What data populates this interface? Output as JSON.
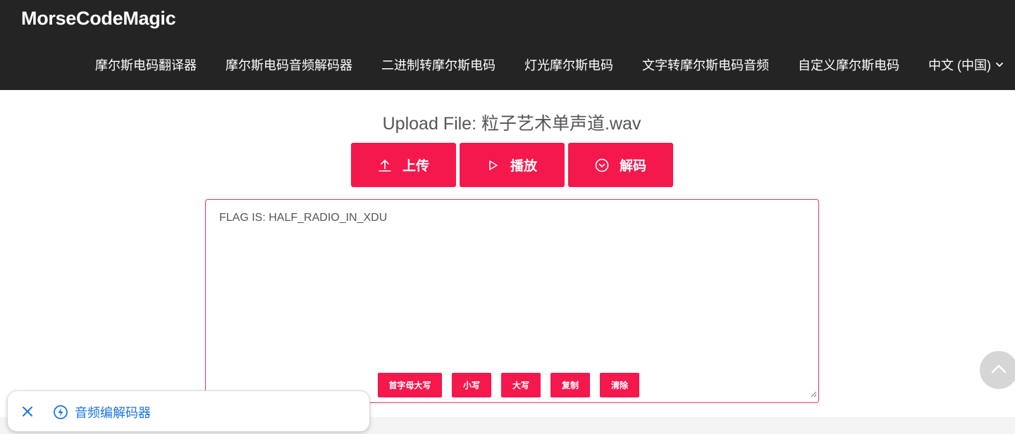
{
  "brand": "MorseCodeMagic",
  "nav": {
    "items": [
      "摩尔斯电码翻译器",
      "摩尔斯电码音频解码器",
      "二进制转摩尔斯电码",
      "灯光摩尔斯电码",
      "文字转摩尔斯电码音频",
      "自定义摩尔斯电码"
    ],
    "language": "中文 (中国)"
  },
  "upload": {
    "title": "Upload File: 粒子艺术单声道.wav"
  },
  "actions": {
    "upload_label": "上传",
    "play_label": "播放",
    "decode_label": "解码"
  },
  "output": {
    "text": "FLAG IS: HALF_RADIO_IN_XDU"
  },
  "text_tools": {
    "capitalize": "首字母大写",
    "lowercase": "小写",
    "uppercase": "大写",
    "copy": "复制",
    "clear": "清除"
  },
  "toast": {
    "label": "音频编解码器"
  },
  "colors": {
    "accent": "#f5184d",
    "navbar": "#242424",
    "link": "#1a73e8"
  }
}
